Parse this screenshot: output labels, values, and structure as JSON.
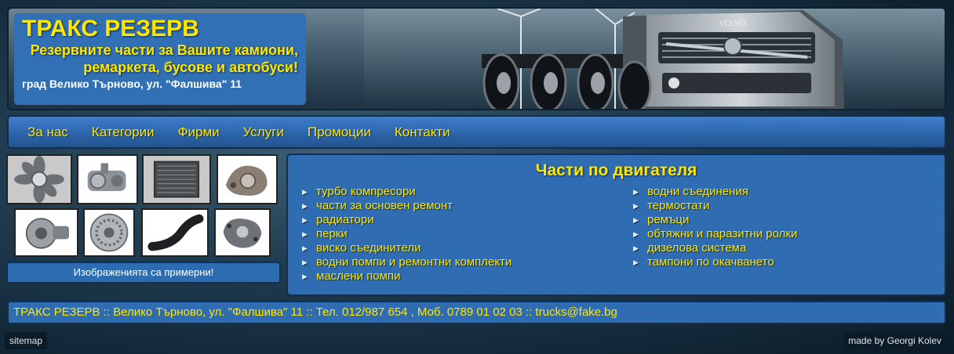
{
  "header": {
    "brand": "ТРАКС РЕЗЕРВ",
    "tagline_1": "Резервните части за Вашите камиони,",
    "tagline_2": "ремаркета, бусове и автобуси!",
    "address": "град Велико Търново, ул. \"Фалшива\" 11",
    "truck_grille_text": "VOLVO"
  },
  "nav": [
    "За нас",
    "Категории",
    "Фирми",
    "Услуги",
    "Промоции",
    "Контакти"
  ],
  "thumbnails": {
    "note": "Изображенията са примерни!"
  },
  "content": {
    "title": "Части по двигателя",
    "column_1": [
      "турбо компресори",
      "части за основен ремонт",
      "радиатори",
      "перки",
      "виско съединители",
      "водни помпи и ремонтни комплекти",
      "маслени помпи"
    ],
    "column_2": [
      "водни съединения",
      "термостати",
      "ремъци",
      "обтяжни и паразитни ролки",
      "дизелова система",
      "тампони по окачването"
    ]
  },
  "footer": {
    "text": "ТРАКС РЕЗЕРВ :: Велико Търново, ул. \"Фалшива\" 11 :: Тел. 012/987 654 , Моб. 0789 01 02 03 :: trucks@fake.bg"
  },
  "bottom": {
    "sitemap": "sitemap",
    "made_by": "made by Georgi Kolev"
  },
  "colors": {
    "accent_yellow": "#ffe600",
    "panel_blue": "#2f6cb2",
    "background_dark": "#142b3c"
  }
}
